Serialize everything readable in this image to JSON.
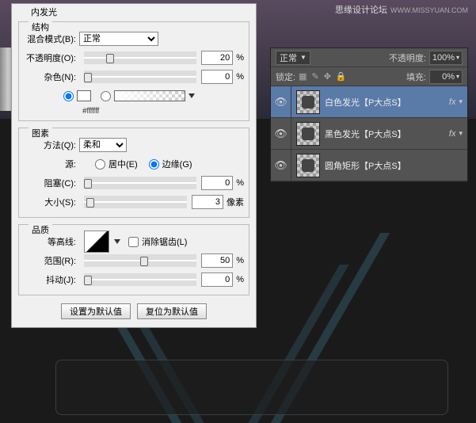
{
  "watermark": {
    "zh": "思缘设计论坛",
    "en": "WWW.MISSYUAN.COM"
  },
  "dialog": {
    "title": "内发光",
    "structure": {
      "legend": "结构",
      "blend_label": "混合模式(B):",
      "blend_value": "正常",
      "opacity_label": "不透明度(O):",
      "opacity_value": "20",
      "opacity_unit": "%",
      "noise_label": "杂色(N):",
      "noise_value": "0",
      "noise_unit": "%",
      "hex": "#ffffff"
    },
    "elements": {
      "legend": "图素",
      "technique_label": "方法(Q):",
      "technique_value": "柔和",
      "source_label": "源:",
      "center": "居中(E)",
      "edge": "边缘(G)",
      "choke_label": "阻塞(C):",
      "choke_value": "0",
      "choke_unit": "%",
      "size_label": "大小(S):",
      "size_value": "3",
      "size_unit": "像素"
    },
    "quality": {
      "legend": "品质",
      "contour_label": "等高线:",
      "antialias": "消除锯齿(L)",
      "range_label": "范围(R):",
      "range_value": "50",
      "range_unit": "%",
      "jitter_label": "抖动(J):",
      "jitter_value": "0",
      "jitter_unit": "%"
    },
    "buttons": {
      "default": "设置为默认值",
      "reset": "复位为默认值"
    }
  },
  "layers": {
    "blend_mode": "正常",
    "opacity_label": "不透明度:",
    "opacity_value": "100%",
    "lock_label": "锁定:",
    "fill_label": "填充:",
    "fill_value": "0%",
    "items": [
      {
        "name": "白色发光【P大点S】",
        "fx": true
      },
      {
        "name": "黑色发光【P大点S】",
        "fx": true
      },
      {
        "name": "圆角矩形【P大点S】",
        "fx": false
      }
    ]
  }
}
